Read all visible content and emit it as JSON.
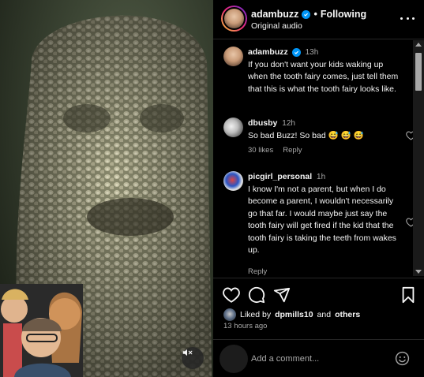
{
  "header": {
    "username": "adambuzz",
    "separator": "•",
    "follow_status": "Following",
    "audio": "Original audio"
  },
  "comments": [
    {
      "username": "adambuzz",
      "time": "13h",
      "text": "If you don't want your kids waking up when the tooth fairy comes, just tell them that this is what the tooth fairy looks like."
    },
    {
      "username": "dbusby",
      "time": "12h",
      "text": "So bad Buzz! So bad 😅 😅 😅",
      "likes": "30 likes",
      "reply": "Reply"
    },
    {
      "username": "picgirl_personal",
      "time": "1h",
      "text": "I know I'm not a parent, but when I do become a parent, I wouldn't necessarily go that far. I would maybe just say the tooth fairy will get fired if the kid that the tooth fairy is taking the teeth from wakes up.",
      "reply": "Reply"
    }
  ],
  "actions": {
    "liked_by_prefix": "Liked by",
    "liked_by_user": "dpmills10",
    "liked_by_and": "and",
    "liked_by_others": "others",
    "post_time": "13 hours ago"
  },
  "comment_box": {
    "placeholder": "Add a comment..."
  },
  "icons": {
    "verified": "verified-badge-icon",
    "more": "more-options-icon",
    "like": "heart-icon",
    "comment": "comment-bubble-icon",
    "share": "paper-plane-icon",
    "save": "bookmark-icon",
    "emoji": "emoji-smile-icon",
    "mute": "speaker-muted-icon"
  },
  "colors": {
    "background": "#000000",
    "text": "#f5f5f5",
    "muted_text": "#a8a8a8",
    "verified": "#0095f6",
    "divider": "#262626"
  }
}
